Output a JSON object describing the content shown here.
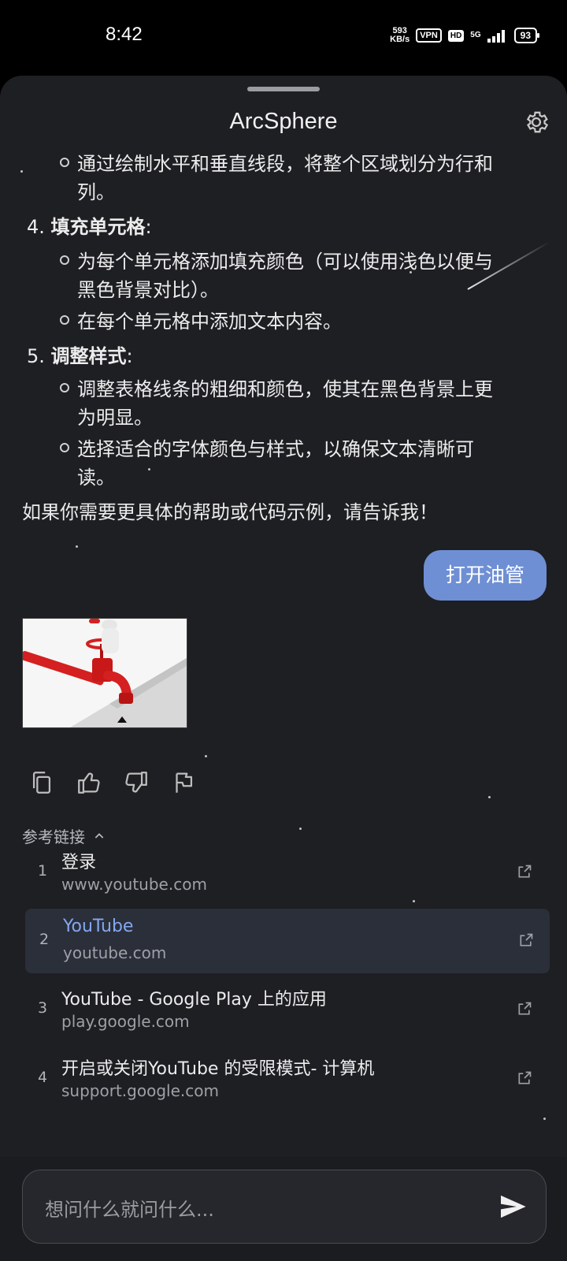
{
  "status_bar": {
    "time": "8:42",
    "net_speed_value": "593",
    "net_speed_unit": "KB/s",
    "vpn": "VPN",
    "hd": "HD",
    "network": "5G",
    "battery": "93"
  },
  "header": {
    "title": "ArcSphere"
  },
  "message": {
    "item3_sub": [
      "通过绘制水平和垂直线段，将整个区域划分为行和",
      "列。"
    ],
    "item4": {
      "num": "4.",
      "title": "填充单元格",
      "colon": ":"
    },
    "item4_sub1": [
      "为每个单元格添加填充颜色（可以使用浅色以便与",
      "黑色背景对比）。"
    ],
    "item4_sub2": "在每个单元格中添加文本内容。",
    "item5": {
      "num": "5.",
      "title": "调整样式",
      "colon": ":"
    },
    "item5_sub1": [
      "调整表格线条的粗细和颜色，使其在黑色背景上更",
      "为明显。"
    ],
    "item5_sub2": [
      "选择适合的字体颜色与样式，以确保文本清晰可",
      "读。"
    ],
    "closing": "如果你需要更具体的帮助或代码示例，请告诉我！"
  },
  "user_message": "打开油管",
  "references": {
    "heading": "参考链接",
    "items": [
      {
        "num": "1",
        "title": "登录",
        "domain": "www.youtube.com"
      },
      {
        "num": "2",
        "title": "YouTube",
        "domain": "youtube.com"
      },
      {
        "num": "3",
        "title": "YouTube - Google Play 上的应用",
        "domain": "play.google.com"
      },
      {
        "num": "4",
        "title": "开启或关闭YouTube 的受限模式- 计算机",
        "domain": "support.google.com"
      }
    ]
  },
  "input": {
    "placeholder": "想问什么就问什么..."
  },
  "colors": {
    "accent": "#6f8fd4",
    "link_active": "#84a8f0",
    "sheet_bg": "#1e1f23"
  },
  "icons": [
    "gear-icon",
    "copy-icon",
    "thumbs-up-icon",
    "thumbs-down-icon",
    "flag-icon",
    "chevron-up-icon",
    "external-link-icon",
    "send-icon"
  ]
}
